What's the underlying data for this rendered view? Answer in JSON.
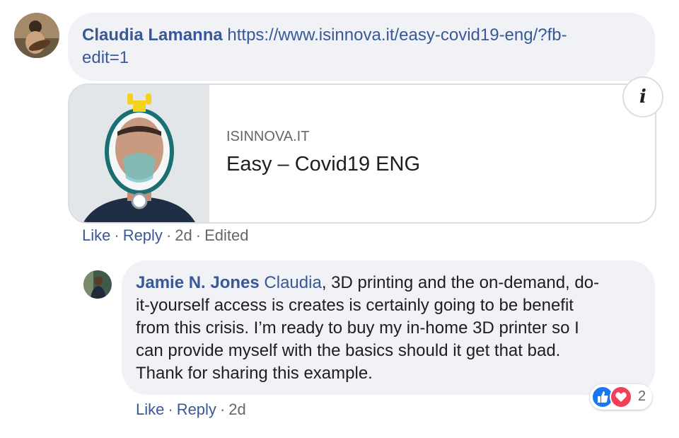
{
  "comment1": {
    "author": "Claudia Lamanna",
    "link_text_line1": "https://www.isinnova.it/easy-covid19-eng/?fb-",
    "link_text_line2": "edit=1",
    "preview": {
      "domain": "ISINNOVA.IT",
      "title": "Easy – Covid19 ENG",
      "info_icon_label": "i"
    },
    "actions": {
      "like": "Like",
      "reply": "Reply",
      "time": "2d",
      "edited": "Edited",
      "separator": "·"
    }
  },
  "comment2": {
    "author": "Jamie N. Jones",
    "mention": "Claudia",
    "lines": [
      ", 3D printing and the on-demand, do-",
      "it-yourself access is creates is certainly going to be benefit",
      "from this crisis. I’m ready to buy my in-home 3D printer so I",
      "can provide myself with the basics should it get that bad.",
      "Thank for sharing this example."
    ],
    "actions": {
      "like": "Like",
      "reply": "Reply",
      "time": "2d",
      "separator": "·"
    },
    "reactions": {
      "icons": [
        "like-icon",
        "love-icon"
      ],
      "count": "2"
    }
  },
  "colors": {
    "link": "#385898",
    "bubble": "#f0f2f5",
    "muted": "#65676b",
    "like_blue": "#1877f2",
    "love_red": "#f33e58"
  }
}
